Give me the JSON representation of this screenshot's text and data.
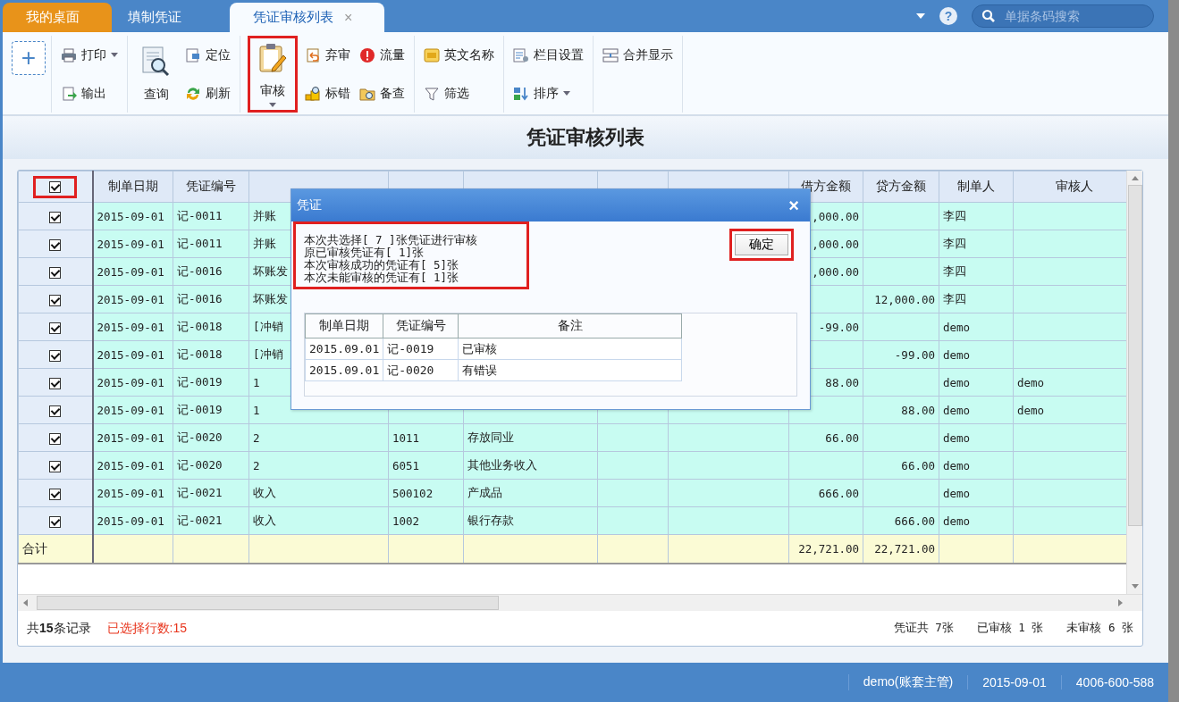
{
  "tabs": [
    {
      "label": "我的桌面",
      "kind": "home",
      "selected": false
    },
    {
      "label": "填制凭证",
      "kind": "doc",
      "selected": false
    },
    {
      "label": "凭证审核列表",
      "kind": "doc",
      "selected": true,
      "close": "×"
    }
  ],
  "header_tools": {
    "help": "?",
    "search": {
      "placeholder": "单据条码搜索"
    }
  },
  "toolbar": {
    "add": "+",
    "groups": [
      {
        "items": [
          {
            "label": "打印",
            "kind": "small",
            "dropdown": true,
            "highlighted": false
          },
          {
            "label": "输出",
            "kind": "small",
            "dropdown": false,
            "highlighted": false
          }
        ]
      },
      {
        "items": [
          {
            "label": "查询",
            "kind": "large",
            "dropdown": false,
            "highlighted": false
          },
          {
            "label": "定位",
            "kind": "small",
            "dropdown": false,
            "highlighted": false
          },
          {
            "label": "刷新",
            "kind": "small",
            "dropdown": false,
            "highlighted": false
          }
        ]
      },
      {
        "items": [
          {
            "label": "审核",
            "kind": "large",
            "dropdown": true,
            "highlighted": true
          },
          {
            "label": "弃审",
            "kind": "small",
            "dropdown": false,
            "highlighted": false
          },
          {
            "label": "标错",
            "kind": "small",
            "dropdown": false,
            "highlighted": false
          },
          {
            "label": "流量",
            "kind": "small",
            "dropdown": false,
            "highlighted": false
          },
          {
            "label": "备查",
            "kind": "small",
            "dropdown": false,
            "highlighted": false
          }
        ]
      },
      {
        "items": [
          {
            "label": "英文名称",
            "kind": "small",
            "dropdown": false,
            "highlighted": false
          },
          {
            "label": "筛选",
            "kind": "small",
            "dropdown": false,
            "highlighted": false
          }
        ]
      },
      {
        "items": [
          {
            "label": "栏目设置",
            "kind": "small",
            "dropdown": false,
            "highlighted": false
          },
          {
            "label": "排序",
            "kind": "small",
            "dropdown": true,
            "highlighted": false
          }
        ]
      },
      {
        "items": [
          {
            "label": "合并显示",
            "kind": "small",
            "dropdown": false,
            "highlighted": false
          }
        ]
      }
    ]
  },
  "page_title": "凭证审核列表",
  "table": {
    "select_all": {
      "checked": true,
      "highlighted": true
    },
    "columns": {
      "date": "制单日期",
      "voucher_no": "凭证编号",
      "debit": "借方金额",
      "credit": "贷方金额",
      "maker": "制单人",
      "auditor": "审核人"
    },
    "rows": [
      {
        "checked": true,
        "date": "2015-09-01",
        "voucher_no": "记-0011",
        "summary": "并账",
        "debit": ",000.00",
        "maker": "李四"
      },
      {
        "checked": true,
        "date": "2015-09-01",
        "voucher_no": "记-0011",
        "summary": "并账",
        "debit": ",000.00",
        "maker": "李四"
      },
      {
        "checked": true,
        "date": "2015-09-01",
        "voucher_no": "记-0016",
        "summary": "坏账发",
        "debit": ",000.00",
        "maker": "李四"
      },
      {
        "checked": true,
        "date": "2015-09-01",
        "voucher_no": "记-0016",
        "summary": "坏账发",
        "credit": "12,000.00",
        "maker": "李四"
      },
      {
        "checked": true,
        "date": "2015-09-01",
        "voucher_no": "记-0018",
        "summary": "[冲销",
        "debit": "-99.00",
        "maker": "demo"
      },
      {
        "checked": true,
        "date": "2015-09-01",
        "voucher_no": "记-0018",
        "summary": "[冲销",
        "credit": "-99.00",
        "maker": "demo"
      },
      {
        "checked": true,
        "date": "2015-09-01",
        "voucher_no": "记-0019",
        "summary": "1",
        "debit": "88.00",
        "maker": "demo",
        "auditor": "demo"
      },
      {
        "checked": true,
        "date": "2015-09-01",
        "voucher_no": "记-0019",
        "summary": "1",
        "credit": "88.00",
        "maker": "demo",
        "auditor": "demo"
      },
      {
        "checked": true,
        "date": "2015-09-01",
        "voucher_no": "记-0020",
        "summary": "2",
        "account_code": "1011",
        "account_name": "存放同业",
        "debit": "66.00",
        "maker": "demo"
      },
      {
        "checked": true,
        "date": "2015-09-01",
        "voucher_no": "记-0020",
        "summary": "2",
        "account_code": "6051",
        "account_name": "其他业务收入",
        "credit": "66.00",
        "maker": "demo"
      },
      {
        "checked": true,
        "date": "2015-09-01",
        "voucher_no": "记-0021",
        "summary": "收入",
        "account_code": "500102",
        "account_name": "产成品",
        "debit": "666.00",
        "maker": "demo"
      },
      {
        "checked": true,
        "date": "2015-09-01",
        "voucher_no": "记-0021",
        "summary": "收入",
        "account_code": "1002",
        "account_name": "银行存款",
        "credit": "666.00",
        "maker": "demo"
      }
    ],
    "total": {
      "label": "合计",
      "debit": "22,721.00",
      "credit": "22,721.00"
    }
  },
  "footer": {
    "records": "共**15**条记录",
    "selected": "已选择行数:15",
    "stats": [
      "凭证共 7张",
      "已审核 1 张",
      "未审核 6 张"
    ]
  },
  "dialog": {
    "title": "凭证",
    "close": "×",
    "message": {
      "highlighted": true,
      "lines": [
        "本次共选择[ 7 ]张凭证进行审核",
        "原已审核凭证有[ 1]张",
        "本次审核成功的凭证有[ 5]张",
        "本次未能审核的凭证有[ 1]张"
      ]
    },
    "ok": {
      "label": "确定",
      "highlighted": true
    },
    "columns": [
      "制单日期",
      "凭证编号",
      "备注"
    ],
    "rows": [
      [
        "2015.09.01",
        "记-0019",
        "已审核"
      ],
      [
        "2015.09.01",
        "记-0020",
        "有错误"
      ]
    ]
  },
  "status_bar": [
    "demo(账套主管)",
    "2015-09-01",
    "4006-600-588"
  ]
}
